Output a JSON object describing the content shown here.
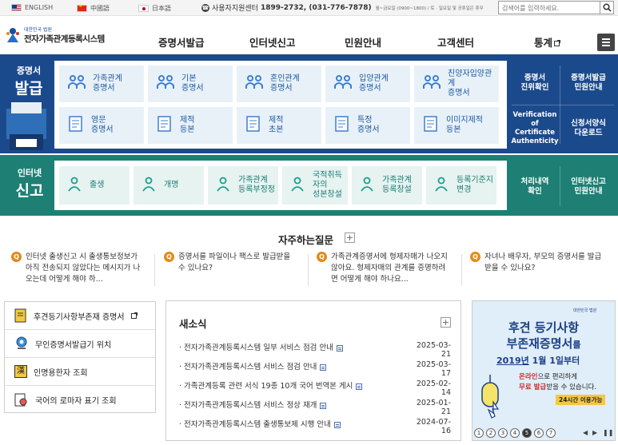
{
  "topbar": {
    "languages": [
      {
        "label": "ENGLISH"
      },
      {
        "label": "中國語"
      },
      {
        "label": "日本語"
      }
    ],
    "hotline_label": "사용자지원센터",
    "hotline_number": "1899-2732, (031-776-7878)",
    "hotline_hours": "월~금요일 (0900~1800) / 토 · 일요일 및 공휴일은 휴무",
    "search_placeholder": "검색어를 입력하세요."
  },
  "header": {
    "org": "대한민국 법원",
    "site_title": "전자가족관계등록시스템",
    "gnb": [
      "증명서발급",
      "인터넷신고",
      "민원안내",
      "고객센터",
      "통계"
    ]
  },
  "certificate": {
    "title_line1": "증명서",
    "title_line2": "발급",
    "tiles": [
      {
        "l1": "가족관계",
        "l2": "증명서"
      },
      {
        "l1": "기본",
        "l2": "증명서"
      },
      {
        "l1": "혼인관계",
        "l2": "증명서"
      },
      {
        "l1": "입양관계",
        "l2": "증명서"
      },
      {
        "l1": "친양자입양관계",
        "l2": "증명서"
      },
      {
        "l1": "영문",
        "l2": "증명서"
      },
      {
        "l1": "제적",
        "l2": "등본"
      },
      {
        "l1": "제적",
        "l2": "초본"
      },
      {
        "l1": "특정",
        "l2": "증명서"
      },
      {
        "l1": "이미지제적",
        "l2": "등본"
      }
    ],
    "tile_badges": {
      "removal": "除籍",
      "image": "이미지"
    },
    "side_links": [
      {
        "l1": "증명서",
        "l2": "진위확인"
      },
      {
        "l1": "증명서발급",
        "l2": "민원안내"
      },
      {
        "l1": "Verification of",
        "l2": "Certificate",
        "l3": "Authenticity"
      },
      {
        "l1": "신청서양식",
        "l2": "다운로드"
      }
    ]
  },
  "report": {
    "title_line1": "인터넷",
    "title_line2": "신고",
    "tiles": [
      {
        "l1": "출생",
        "l2": ""
      },
      {
        "l1": "개명",
        "l2": ""
      },
      {
        "l1": "가족관계",
        "l2": "등록부정정"
      },
      {
        "l1": "국적취득자의",
        "l2": "성본창설"
      },
      {
        "l1": "가족관계",
        "l2": "등록창설"
      },
      {
        "l1": "등록기준지",
        "l2": "변경"
      }
    ],
    "side_links": [
      {
        "l1": "처리내역",
        "l2": "확인"
      },
      {
        "l1": "인터넷신고",
        "l2": "민원안내"
      }
    ]
  },
  "faq": {
    "title": "자주하는질문",
    "plus": "+",
    "q_mark": "Q",
    "items": [
      {
        "l1": "인터넷 출생신고 시 출생통보정보가",
        "l2": "아직 전송되지 않았다는 메시지가 나",
        "l3": "오는데 어떻게 해야 하..."
      },
      {
        "l1": "증명서를 파일이나 팩스로 발급받을",
        "l2": "수 있나요?",
        "l3": ""
      },
      {
        "l1": "가족관계증명서에 형제자매가 나오지",
        "l2": "않아요. 형제자매의 관계를 증명하려",
        "l3": "면 어떻게 해야 하나요..."
      },
      {
        "l1": "자녀나 배우자, 부모의 증명서를 발급",
        "l2": "받을 수 있나요?",
        "l3": ""
      }
    ]
  },
  "quick_links": [
    {
      "label": "후견등기사항부존재 증명서"
    },
    {
      "label": "무인증명서발급기 위치"
    },
    {
      "label": "인명용한자 조회"
    },
    {
      "label": "국어의 로마자 표기 조회"
    }
  ],
  "quick_badge": "漢",
  "news": {
    "title": "새소식",
    "plus": "+",
    "items": [
      {
        "text": "전자가족관계등록시스템 일부 서비스 점검 안내",
        "date": "2025-03-21"
      },
      {
        "text": "전자가족관계등록시스템 서비스 점검 안내",
        "date": "2025-03-17"
      },
      {
        "text": "가족관계등록 관련 서식 19종 10개 국어 번역본 게시",
        "date": "2025-02-14"
      },
      {
        "text": "전자가족관계등록시스템 서비스 정상 재개",
        "date": "2025-01-21"
      },
      {
        "text": "전자가족관계등록시스템 출생통보제 시행 안내",
        "date": "2024-07-16"
      }
    ]
  },
  "banner": {
    "org": "대한민국 법원",
    "line1": "후견 등기사항",
    "line2a": "부존재증명서",
    "line2b": "를",
    "year": "2019년",
    "date": "1월 1일부터",
    "sub1a": "온라인",
    "sub1b": "으로 편리하게",
    "sub2a": "무료 발급",
    "sub2b": "받을 수 있습니다.",
    "badge": "24시간 이용가능",
    "pages": [
      "1",
      "2",
      "3",
      "4",
      "5",
      "6",
      "7"
    ],
    "active_page": 5
  }
}
